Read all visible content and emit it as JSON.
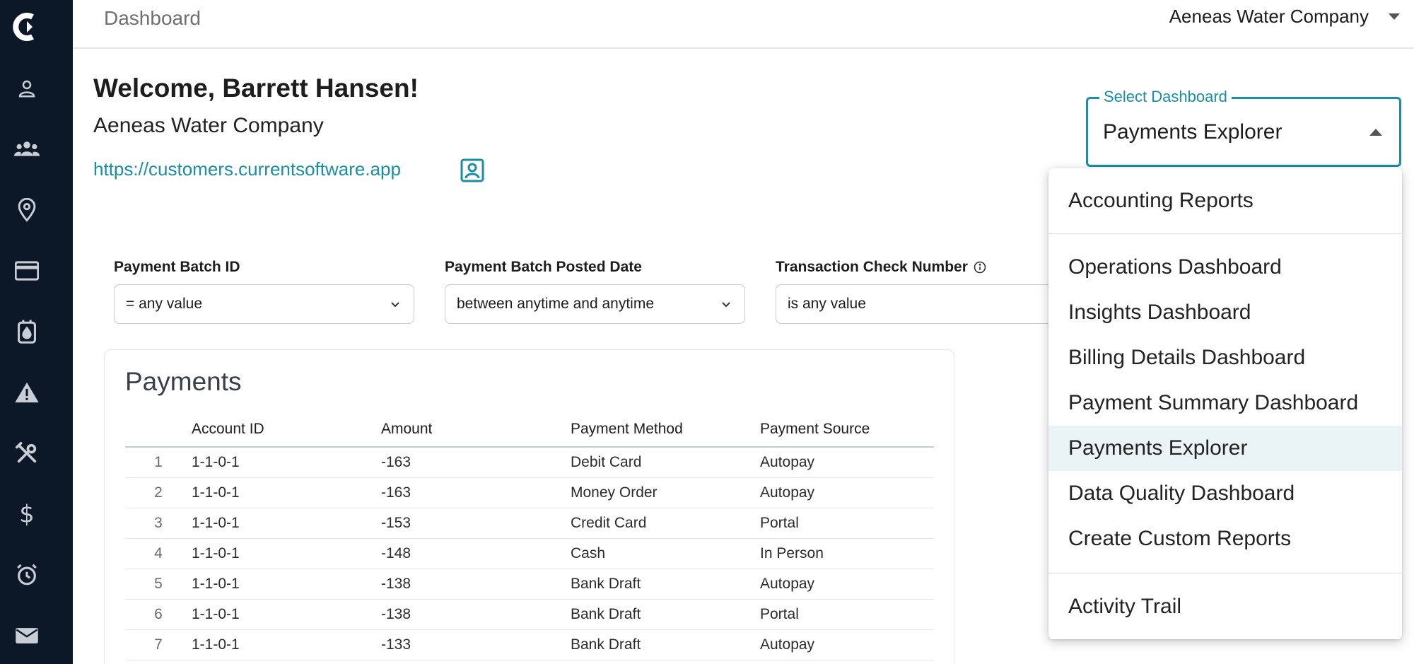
{
  "header": {
    "page_title": "Dashboard",
    "company_selector": "Aeneas Water Company"
  },
  "sidebar": {
    "items": [
      {
        "icon": "person-icon"
      },
      {
        "icon": "group-icon"
      },
      {
        "icon": "location-pin-icon"
      },
      {
        "icon": "credit-card-icon"
      },
      {
        "icon": "meter-icon"
      },
      {
        "icon": "warning-icon"
      },
      {
        "icon": "tools-icon"
      },
      {
        "icon": "dollar-icon"
      },
      {
        "icon": "alarm-clock-icon"
      },
      {
        "icon": "mail-icon"
      }
    ]
  },
  "welcome": {
    "greeting": "Welcome, Barrett Hansen!",
    "company": "Aeneas Water Company",
    "link": "https://customers.currentsoftware.app"
  },
  "dashboard_select": {
    "label": "Select Dashboard",
    "value": "Payments Explorer"
  },
  "filters": [
    {
      "label": "Payment Batch ID",
      "value": "= any value"
    },
    {
      "label": "Payment Batch Posted Date",
      "value": "between anytime and anytime"
    },
    {
      "label": "Transaction Check Number",
      "value": "is any value"
    }
  ],
  "payments": {
    "title": "Payments",
    "columns": [
      "Account ID",
      "Amount",
      "Payment Method",
      "Payment Source"
    ],
    "rows": [
      {
        "n": "1",
        "account": "1-1-0-1",
        "amount": "-163",
        "method": "Debit Card",
        "source": "Autopay"
      },
      {
        "n": "2",
        "account": "1-1-0-1",
        "amount": "-163",
        "method": "Money Order",
        "source": "Autopay"
      },
      {
        "n": "3",
        "account": "1-1-0-1",
        "amount": "-153",
        "method": "Credit Card",
        "source": "Portal"
      },
      {
        "n": "4",
        "account": "1-1-0-1",
        "amount": "-148",
        "method": "Cash",
        "source": "In Person"
      },
      {
        "n": "5",
        "account": "1-1-0-1",
        "amount": "-138",
        "method": "Bank Draft",
        "source": "Autopay"
      },
      {
        "n": "6",
        "account": "1-1-0-1",
        "amount": "-138",
        "method": "Bank Draft",
        "source": "Portal"
      },
      {
        "n": "7",
        "account": "1-1-0-1",
        "amount": "-133",
        "method": "Bank Draft",
        "source": "Autopay"
      }
    ]
  },
  "dashboard_menu": {
    "items": [
      "Accounting Reports",
      "Operations Dashboard",
      "Insights Dashboard",
      "Billing Details Dashboard",
      "Payment Summary Dashboard",
      "Payments Explorer",
      "Data Quality Dashboard",
      "Create Custom Reports",
      "Activity Trail"
    ],
    "selected": "Payments Explorer"
  },
  "colors": {
    "sidebar_bg": "#0c1728",
    "accent": "#1a8fa1",
    "selected_item_bg": "#eaf4f6"
  }
}
